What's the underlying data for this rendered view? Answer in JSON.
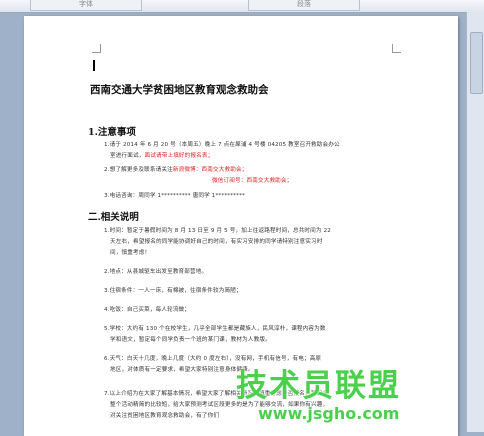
{
  "tabs": [
    "字体",
    "段落"
  ],
  "document": {
    "title": "西南交通大学贫困地区教育观念救助会",
    "section1": {
      "heading": "1.注意事项",
      "items": [
        {
          "text": "1.请于 2014 年 6 月 20 号（本周五）晚上 7 点在犀浦 4 号楼 04205 教室召开救助会办公"
        },
        {
          "text": "室进行面试，",
          "red": "面试请带上填好的报名表；"
        },
        {
          "text": "2.想了解更多及联系请关注",
          "red": "新浪微博：西南交大救助会；"
        },
        {
          "red": "微信订阅号：西南交大救助会；"
        },
        {
          "text": "3.电话咨询：周同学  1**********        唐同学  1**********"
        }
      ]
    },
    "section2": {
      "heading": "二.相关说明",
      "items": [
        {
          "text": "1.时间：暂定于暑假时间为 8 月 13 日至 9 月 5 号，加上往返路程时间，总共时间为 22"
        },
        {
          "text": "天左右，希望报名的同学能协调好自己的时间，有实习安排的同学请特别注意实习时"
        },
        {
          "text": "间，慎重考虑！"
        },
        {
          "text": "2.地点：从县城驱车出发至教育部营地。"
        },
        {
          "text": "3.住宿条件：一人一床，有棉被，住宿条件较为简陋；"
        },
        {
          "text": "4.吃饭：自己买菜，每人轮流做；"
        },
        {
          "text": "5.学校：大约有 130 个在校学生，几乎全部学生都是藏族人，民风淳朴，课程内容为数"
        },
        {
          "text": "学和语文，暂定每个同学负责一个班的某门课，教材为人教版。"
        },
        {
          "text": "6.天气：白天十几度，晚上几度（大约 0 度左右），没有网，手机有信号，有电；高原"
        },
        {
          "text": "地区，对体质有一定要求，希望大家特别注意身体健康。"
        },
        {
          "text": "7.以上介绍为在大家了解基本情况，希望大家了解相关情况后慎重考虑是否报名，我们会"
        },
        {
          "text": "整个活动精简的比较短，给大家预测考试区段更多的是为了能够交流，如果你有兴趣，"
        },
        {
          "text": "对关注贫困地区教育观念救助会，有了你们"
        }
      ]
    }
  },
  "watermark": {
    "text": "技术员联盟",
    "url": "www.jsgho.com",
    "color": "#49d14b"
  }
}
